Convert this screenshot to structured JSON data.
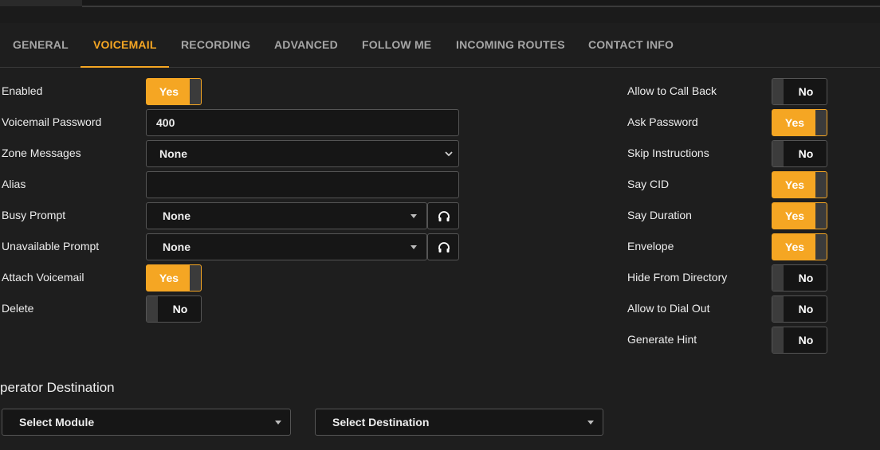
{
  "tabs": [
    {
      "label": "GENERAL"
    },
    {
      "label": "VOICEMAIL"
    },
    {
      "label": "RECORDING"
    },
    {
      "label": "ADVANCED"
    },
    {
      "label": "FOLLOW ME"
    },
    {
      "label": "INCOMING ROUTES"
    },
    {
      "label": "CONTACT INFO"
    }
  ],
  "active_tab": "VOICEMAIL",
  "left": {
    "enabled": {
      "label": "Enabled",
      "value": "Yes"
    },
    "password": {
      "label": "Voicemail Password",
      "value": "400"
    },
    "zone": {
      "label": "Zone Messages",
      "value": "None"
    },
    "alias": {
      "label": "Alias",
      "value": ""
    },
    "busy": {
      "label": "Busy Prompt",
      "value": "None"
    },
    "unavailable": {
      "label": "Unavailable Prompt",
      "value": "None"
    },
    "attach": {
      "label": "Attach Voicemail",
      "value": "Yes"
    },
    "delete": {
      "label": "Delete",
      "value": "No"
    }
  },
  "right": {
    "call_back": {
      "label": "Allow to Call Back",
      "value": "No"
    },
    "ask_password": {
      "label": "Ask Password",
      "value": "Yes"
    },
    "skip_instructions": {
      "label": "Skip Instructions",
      "value": "No"
    },
    "say_cid": {
      "label": "Say CID",
      "value": "Yes"
    },
    "say_duration": {
      "label": "Say Duration",
      "value": "Yes"
    },
    "envelope": {
      "label": "Envelope",
      "value": "Yes"
    },
    "hide_directory": {
      "label": "Hide From Directory",
      "value": "No"
    },
    "dial_out": {
      "label": "Allow to Dial Out",
      "value": "No"
    },
    "generate_hint": {
      "label": "Generate Hint",
      "value": "No"
    }
  },
  "operator": {
    "title": "perator Destination",
    "module": "Select Module",
    "destination": "Select Destination"
  },
  "colors": {
    "accent": "#f5a623",
    "background": "#1e1e1e"
  },
  "icons": {
    "prompt_play": "headphones-icon",
    "dropdown": "caret-down-icon"
  }
}
